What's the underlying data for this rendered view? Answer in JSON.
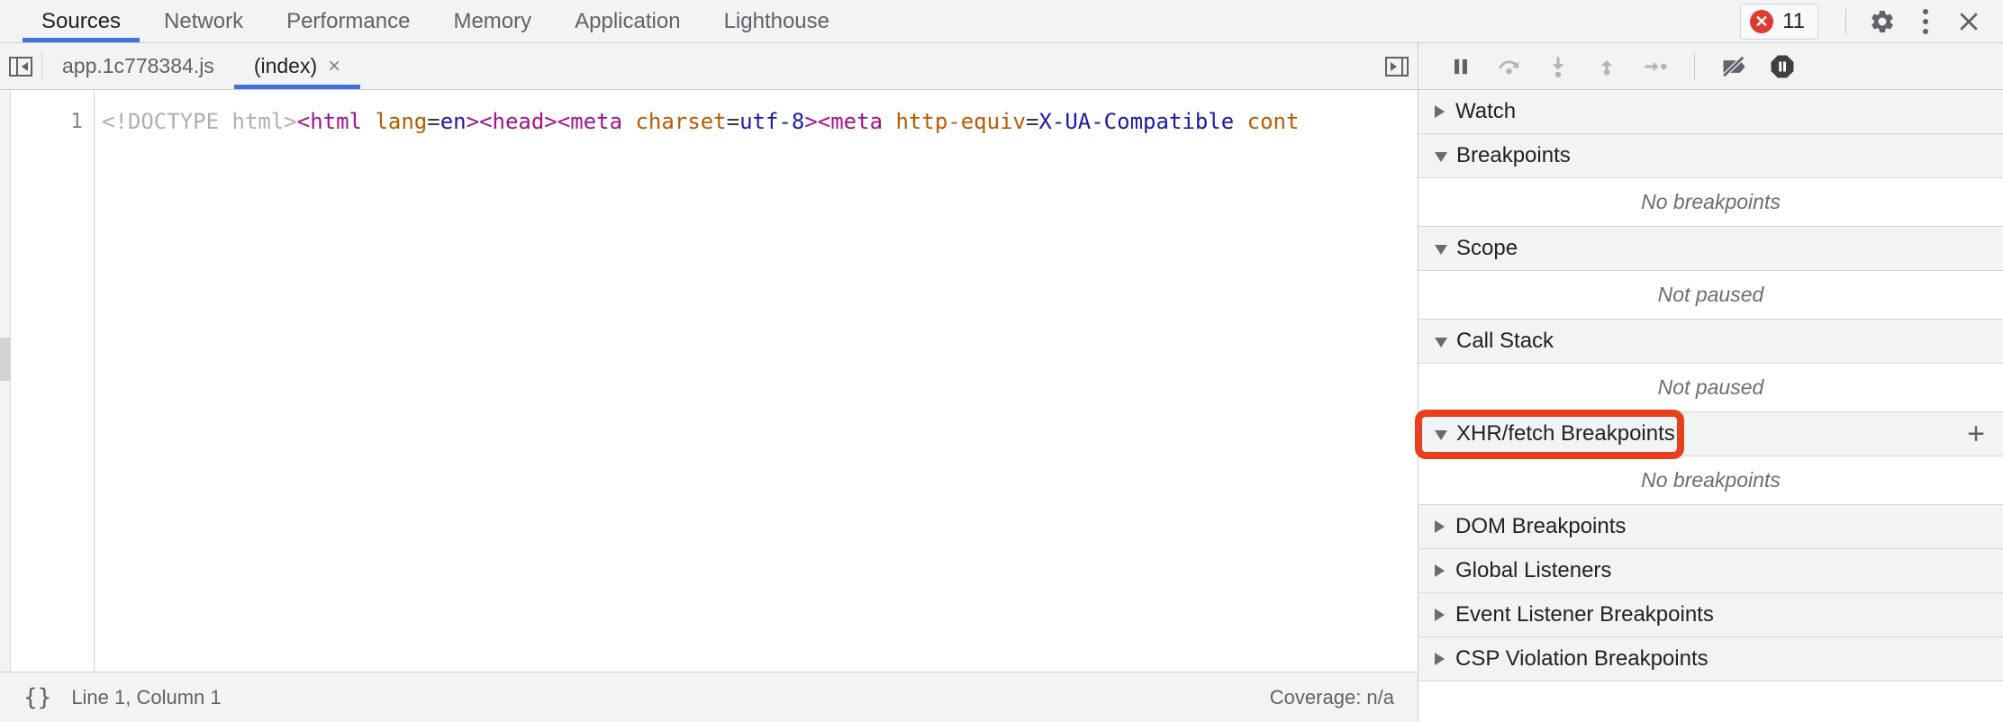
{
  "top_toolbar": {
    "tabs": [
      {
        "label": "Sources",
        "active": true
      },
      {
        "label": "Network",
        "active": false
      },
      {
        "label": "Performance",
        "active": false
      },
      {
        "label": "Memory",
        "active": false
      },
      {
        "label": "Application",
        "active": false
      },
      {
        "label": "Lighthouse",
        "active": false
      }
    ],
    "error_badge": {
      "icon": "error-circle-icon",
      "count": "11"
    },
    "settings_icon": "gear-icon",
    "more_icon": "kebab-menu-icon",
    "close_icon": "close-icon",
    "accent_color": "#4273db",
    "error_color": "#dd3b30"
  },
  "file_tabbar": {
    "navigator_toggle_icon": "show-navigator-icon",
    "drawer_toggle_icon": "show-debugger-icon",
    "tabs": [
      {
        "label": "app.1c778384.js",
        "active": false,
        "closable": false
      },
      {
        "label": "(index)",
        "active": true,
        "closable": true,
        "close_label": "×"
      }
    ]
  },
  "editor": {
    "line_number": "1",
    "code_tokens": [
      {
        "text": "<!DOCTYPE html>",
        "type": "doctype"
      },
      {
        "text": "<html",
        "type": "tag"
      },
      {
        "text": " ",
        "type": "plain"
      },
      {
        "text": "lang",
        "type": "attr"
      },
      {
        "text": "=",
        "type": "eq"
      },
      {
        "text": "en",
        "type": "val"
      },
      {
        "text": ">",
        "type": "tag"
      },
      {
        "text": "<head>",
        "type": "tag"
      },
      {
        "text": "<meta",
        "type": "tag"
      },
      {
        "text": " ",
        "type": "plain"
      },
      {
        "text": "charset",
        "type": "attr"
      },
      {
        "text": "=",
        "type": "eq"
      },
      {
        "text": "utf-8",
        "type": "val"
      },
      {
        "text": ">",
        "type": "tag"
      },
      {
        "text": "<meta",
        "type": "tag"
      },
      {
        "text": " ",
        "type": "plain"
      },
      {
        "text": "http-equiv",
        "type": "attr"
      },
      {
        "text": "=",
        "type": "eq"
      },
      {
        "text": "X-UA-Compatible",
        "type": "val"
      },
      {
        "text": " ",
        "type": "plain"
      },
      {
        "text": "cont",
        "type": "attr"
      }
    ],
    "colors": {
      "doctype": "#b0b0b0",
      "tag": "#a3128e",
      "attr": "#ba5a00",
      "value": "#1a1aa6"
    }
  },
  "status_bar": {
    "pretty_print_icon": "{}",
    "cursor_position": "Line 1, Column 1",
    "coverage": "Coverage: n/a"
  },
  "debug_toolbar": {
    "buttons": [
      {
        "name": "pause-resume-button",
        "icon": "pause-icon",
        "state": "active"
      },
      {
        "name": "step-over-button",
        "icon": "step-over-icon",
        "state": "disabled"
      },
      {
        "name": "step-into-button",
        "icon": "step-into-icon",
        "state": "disabled"
      },
      {
        "name": "step-out-button",
        "icon": "step-out-icon",
        "state": "disabled"
      },
      {
        "name": "step-button",
        "icon": "step-icon",
        "state": "disabled"
      },
      {
        "name": "deactivate-breakpoints-button",
        "icon": "breakpoint-slashed-icon",
        "state": "active"
      },
      {
        "name": "pause-on-exceptions-button",
        "icon": "pause-octagon-icon",
        "state": "active"
      }
    ]
  },
  "debug_sections": [
    {
      "title": "Watch",
      "expanded": false,
      "body": null,
      "add_button": null,
      "highlighted": false
    },
    {
      "title": "Breakpoints",
      "expanded": true,
      "body": "No breakpoints",
      "add_button": null,
      "highlighted": false
    },
    {
      "title": "Scope",
      "expanded": true,
      "body": "Not paused",
      "add_button": null,
      "highlighted": false
    },
    {
      "title": "Call Stack",
      "expanded": true,
      "body": "Not paused",
      "add_button": null,
      "highlighted": false
    },
    {
      "title": "XHR/fetch Breakpoints",
      "expanded": true,
      "body": "No breakpoints",
      "add_button": "+",
      "highlighted": true
    },
    {
      "title": "DOM Breakpoints",
      "expanded": false,
      "body": null,
      "add_button": null,
      "highlighted": false
    },
    {
      "title": "Global Listeners",
      "expanded": false,
      "body": null,
      "add_button": null,
      "highlighted": false
    },
    {
      "title": "Event Listener Breakpoints",
      "expanded": false,
      "body": null,
      "add_button": null,
      "highlighted": false
    },
    {
      "title": "CSP Violation Breakpoints",
      "expanded": false,
      "body": null,
      "add_button": null,
      "highlighted": false
    }
  ],
  "annotation": {
    "type": "highlight-rectangle",
    "target": "XHR/fetch Breakpoints",
    "color": "#e8401f"
  }
}
